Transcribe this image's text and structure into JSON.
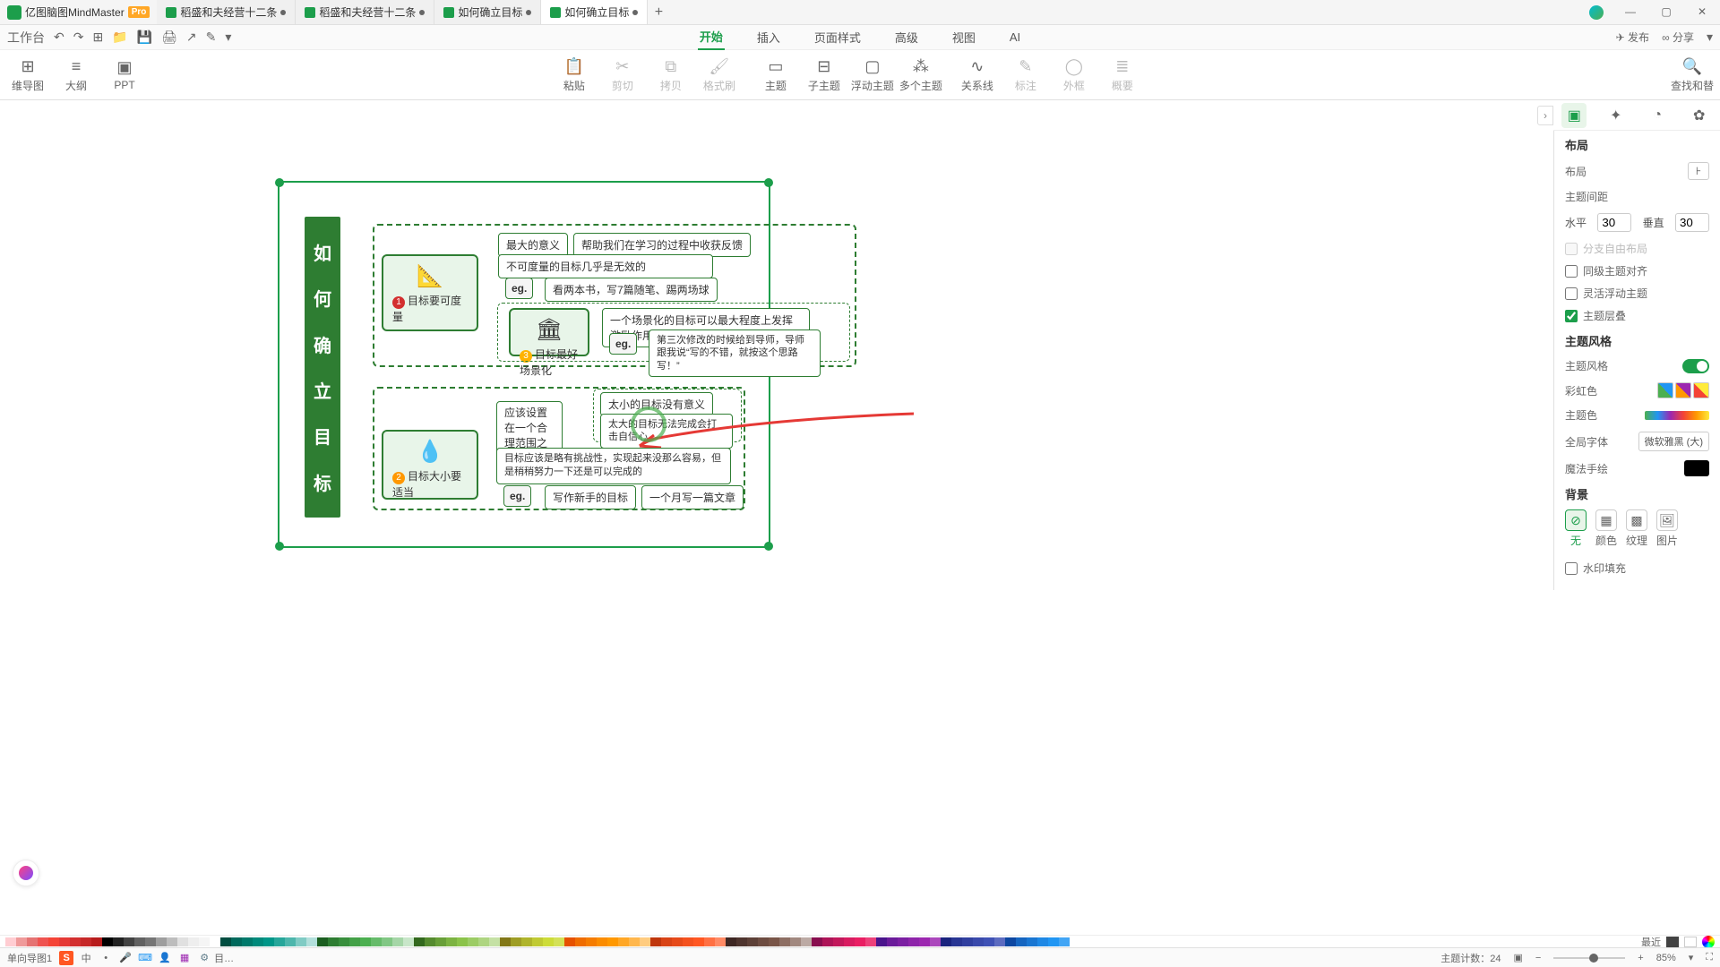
{
  "app": {
    "title": "亿图脑图MindMaster",
    "pro": "Pro"
  },
  "tabs": [
    {
      "label": "稻盛和夫经营十二条",
      "dirty": true
    },
    {
      "label": "稻盛和夫经营十二条",
      "dirty": true
    },
    {
      "label": "如何确立目标",
      "dirty": true
    },
    {
      "label": "如何确立目标",
      "dirty": true
    }
  ],
  "window": {
    "min": "—",
    "max": "▢",
    "close": "✕"
  },
  "quick": {
    "workbench": "工作台"
  },
  "qright": {
    "publish": "发布",
    "share": "分享"
  },
  "menu": {
    "start": "开始",
    "insert": "插入",
    "page": "页面样式",
    "advanced": "高级",
    "view": "视图",
    "ai": "AI"
  },
  "ribbon": {
    "mindmap": "维导图",
    "outline": "大纲",
    "ppt": "PPT",
    "paste": "粘贴",
    "cut": "剪切",
    "copy": "拷贝",
    "format": "格式刷",
    "topic": "主题",
    "subtopic": "子主题",
    "float": "浮动主题",
    "multi": "多个主题",
    "relation": "关系线",
    "note": "标注",
    "link": "外框",
    "summary": "概要",
    "find": "查找和替"
  },
  "map": {
    "root": "如何确立目标",
    "s1": {
      "title": "目标要可度量"
    },
    "s2": {
      "title": "目标最好场景化"
    },
    "s3": {
      "title": "目标大小要适当"
    },
    "n_max_meaning": "最大的意义",
    "n_feedback": "帮助我们在学习的过程中收获反馈",
    "n_invalid": "不可度量的目标几乎是无效的",
    "n_eg1": "eg.",
    "n_egtxt1": "看两本书，写7篇随笔、踢两场球",
    "n_scene": "一个场景化的目标可以最大程度上发挥激励作用",
    "n_eg2": "eg.",
    "n_egtxt2": "第三次修改的时候给到导师，导师跟我说“写的不错，就按这个思路写！”",
    "n_range": "应该设置在一个合理范围之内",
    "n_too_small": "太小的目标没有意义",
    "n_too_big": "太大的目标无法完成会打击自信心",
    "n_challenge": "目标应该是略有挑战性，实现起来没那么容易，但是稍稍努力一下还是可以完成的",
    "n_eg3": "eg.",
    "n_newwriter": "写作新手的目标",
    "n_month": "一个月写一篇文章"
  },
  "rpanel": {
    "layout_section": "布局",
    "layout": "布局",
    "spacing": "主题间距",
    "h": "水平",
    "hval": "30",
    "v": "垂直",
    "vval": "30",
    "freebranch": "分支自由布局",
    "align": "同级主题对齐",
    "flexfloat": "灵活浮动主题",
    "overlap": "主题层叠",
    "style_section": "主题风格",
    "style": "主题风格",
    "rainbow": "彩虹色",
    "themecolor": "主题色",
    "globalfont": "全局字体",
    "fontval": "微软雅黑 (大)",
    "magic": "魔法手绘",
    "bg_section": "背景",
    "bg_none": "无",
    "bg_color": "颜色",
    "bg_texture": "纹理",
    "bg_image": "图片",
    "watermark": "水印填充"
  },
  "colorbar": {
    "recent": "最近"
  },
  "status": {
    "singlemap": "单向导图1",
    "lang": "中",
    "topic_count_label": "主题计数：",
    "topic_count": "24",
    "zoom": "85%"
  }
}
